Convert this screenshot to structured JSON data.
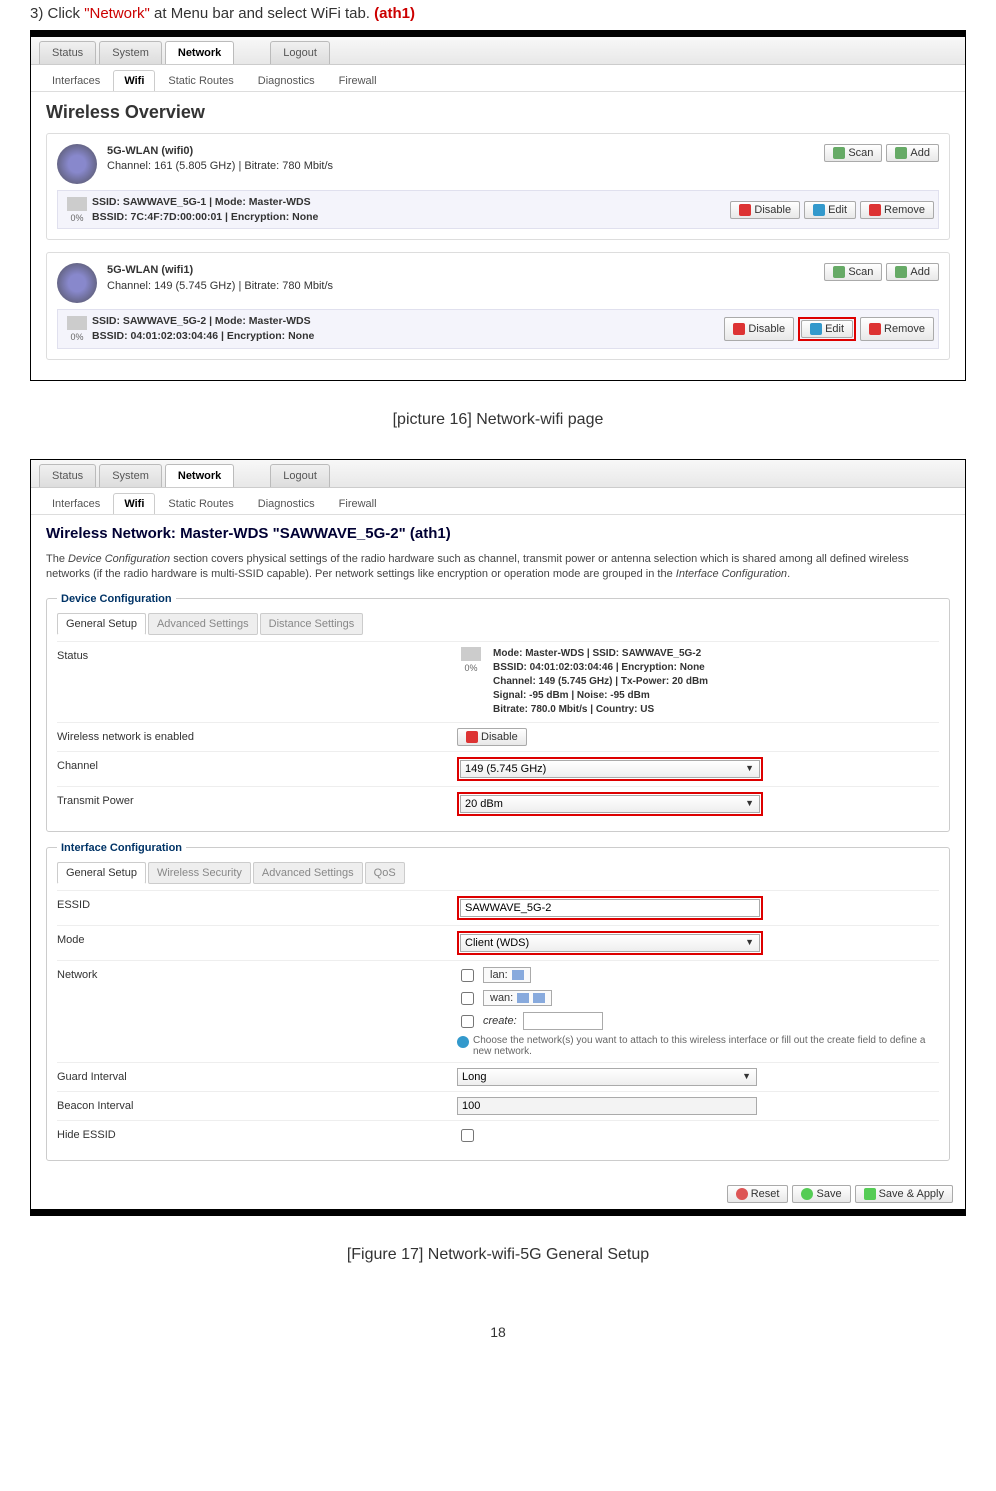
{
  "instruction": {
    "num": "3)",
    "pre": "Click ",
    "q1": "\"Network\"",
    "mid": " at Menu bar and select WiFi tab. ",
    "q2": "(ath1)"
  },
  "menu": {
    "status": "Status",
    "system": "System",
    "network": "Network",
    "logout": "Logout"
  },
  "submenu": {
    "interfaces": "Interfaces",
    "wifi": "Wifi",
    "static": "Static Routes",
    "diag": "Diagnostics",
    "firewall": "Firewall"
  },
  "s1": {
    "title": "Wireless Overview",
    "w0": {
      "name": "5G-WLAN (wifi0)",
      "chan": "Channel: 161 (5.805 GHz) | Bitrate: 780 Mbit/s",
      "ssid": "SSID: SAWWAVE_5G-1 | Mode: Master-WDS",
      "bssid": "BSSID: 7C:4F:7D:00:00:01 | Encryption: None",
      "pct": "0%"
    },
    "w1": {
      "name": "5G-WLAN (wifi1)",
      "chan": "Channel: 149 (5.745 GHz) | Bitrate: 780 Mbit/s",
      "ssid": "SSID: SAWWAVE_5G-2 | Mode: Master-WDS",
      "bssid": "BSSID: 04:01:02:03:04:46 | Encryption: None",
      "pct": "0%"
    }
  },
  "btns": {
    "scan": "Scan",
    "add": "Add",
    "disable": "Disable",
    "edit": "Edit",
    "remove": "Remove",
    "reset": "Reset",
    "save": "Save",
    "apply": "Save & Apply"
  },
  "cap1": "[picture 16] Network-wifi page",
  "s2": {
    "title": "Wireless Network: Master-WDS \"SAWWAVE_5G-2\" (ath1)",
    "desc1": "The ",
    "em1": "Device Configuration",
    "desc2": " section covers physical settings of the radio hardware such as channel, transmit power or antenna selection which is shared among all defined wireless networks (if the radio hardware is multi-SSID capable). Per network settings like encryption or operation mode are grouped in the ",
    "em2": "Interface Configuration",
    "desc3": ".",
    "leg1": "Device Configuration",
    "leg2": "Interface Configuration",
    "it": {
      "gs": "General Setup",
      "as": "Advanced Settings",
      "ds": "Distance Settings",
      "ws": "Wireless Security",
      "qos": "QoS"
    },
    "lbl": {
      "status": "Status",
      "wne": "Wireless network is enabled",
      "chan": "Channel",
      "txp": "Transmit Power",
      "essid": "ESSID",
      "mode": "Mode",
      "net": "Network",
      "gi": "Guard Interval",
      "bi": "Beacon Interval",
      "he": "Hide ESSID"
    },
    "status": {
      "pct": "0%",
      "l1": "Mode: Master-WDS | SSID: SAWWAVE_5G-2",
      "l2": "BSSID: 04:01:02:03:04:46 | Encryption: None",
      "l3": "Channel: 149 (5.745 GHz) | Tx-Power: 20 dBm",
      "l4": "Signal: -95 dBm | Noise: -95 dBm",
      "l5": "Bitrate: 780.0 Mbit/s | Country: US"
    },
    "val": {
      "chan": "149 (5.745 GHz)",
      "txp": "20 dBm",
      "essid": "SAWWAVE_5G-2",
      "mode": "Client (WDS)",
      "gi": "Long",
      "bi": "100"
    },
    "net": {
      "lan": "lan:",
      "wan": "wan:",
      "create": "create:",
      "help": "Choose the network(s) you want to attach to this wireless interface or fill out the create field to define a new network."
    }
  },
  "cap2": "[Figure 17]  Network-wifi-5G General Setup",
  "pagenum": "18"
}
